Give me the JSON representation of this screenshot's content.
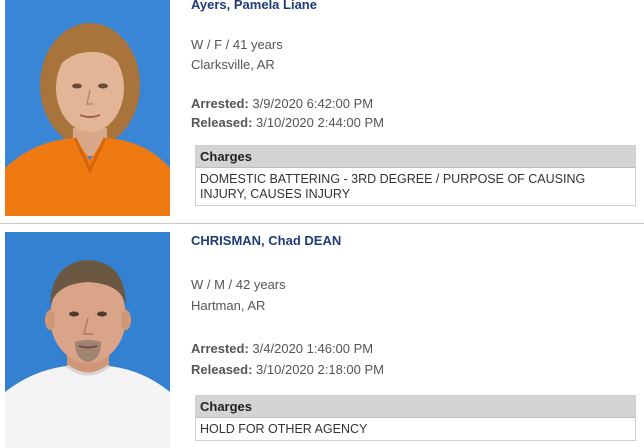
{
  "records": [
    {
      "name": "Ayers, Pamela Liane",
      "demographics": "W / F / 41 years",
      "location": "Clarksville, AR",
      "arrested_label": "Arrested:",
      "arrested": "3/9/2020 6:42:00 PM",
      "released_label": "Released:",
      "released": "3/10/2020 2:44:00 PM",
      "charges_header": "Charges",
      "charges": "DOMESTIC BATTERING - 3RD DEGREE / PURPOSE OF CAUSING INJURY, CAUSES INJURY",
      "colors": {
        "background": "#3a86d6",
        "shirt": "#f07a12",
        "hair": "#a8743c",
        "skin": "#e2b596"
      }
    },
    {
      "name": "CHRISMAN, Chad DEAN",
      "demographics": "W / M / 42 years",
      "location": "Hartman, AR",
      "arrested_label": "Arrested:",
      "arrested": "3/4/2020 1:46:00 PM",
      "released_label": "Released:",
      "released": "3/10/2020 2:18:00 PM",
      "charges_header": "Charges",
      "charges": "HOLD FOR OTHER AGENCY",
      "colors": {
        "background": "#3481d2",
        "shirt": "#f4f4f4",
        "hair": "#6b5843",
        "skin": "#d9a487"
      }
    }
  ]
}
